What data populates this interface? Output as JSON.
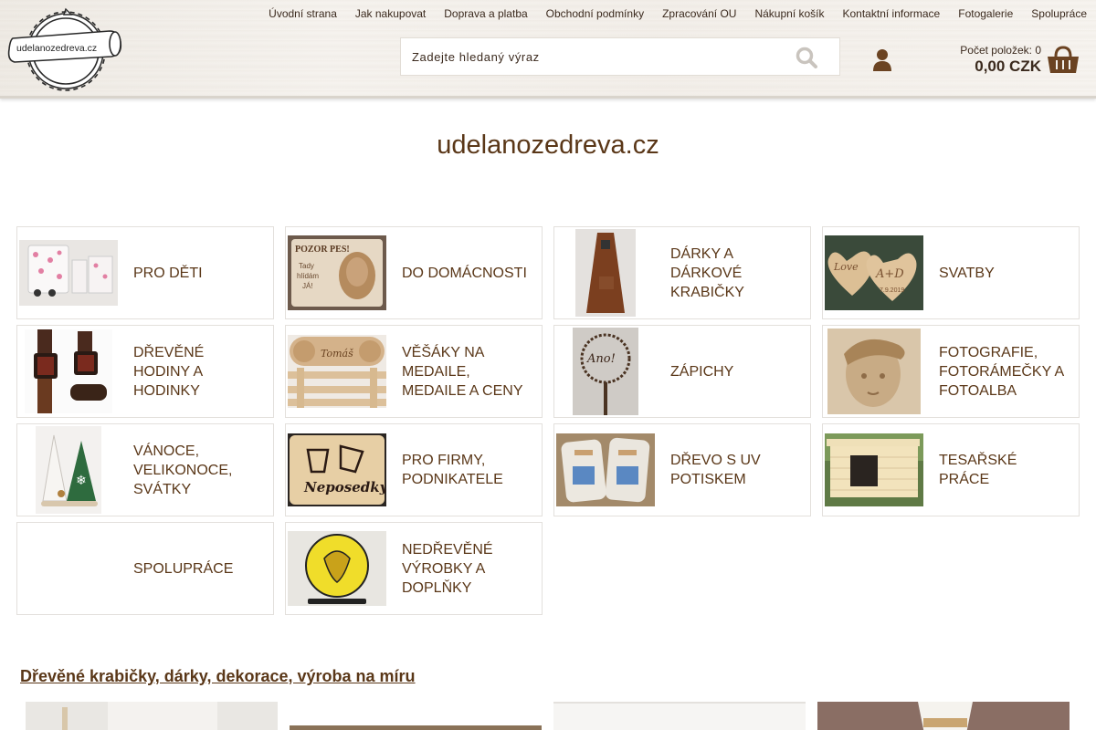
{
  "header": {
    "logo_text": "udelanozedreva.cz",
    "nav": [
      {
        "label": "Úvodní strana"
      },
      {
        "label": "Jak nakupovat"
      },
      {
        "label": "Doprava a platba"
      },
      {
        "label": "Obchodní podmínky"
      },
      {
        "label": "Zpracování OU"
      },
      {
        "label": "Nákupní košík"
      },
      {
        "label": "Kontaktní informace"
      },
      {
        "label": "Fotogalerie"
      },
      {
        "label": "Spolupráce"
      }
    ],
    "search": {
      "placeholder": "Zadejte hledaný výraz",
      "icon": "search-icon"
    },
    "user_icon": "user-icon",
    "cart": {
      "count_label": "Počet položek: 0",
      "total": "0,00 CZK",
      "icon": "basket-icon"
    }
  },
  "main": {
    "title": "udelanozedreva.cz",
    "categories": [
      {
        "label": "PRO DĚTI"
      },
      {
        "label": "DO DOMÁCNOSTI"
      },
      {
        "label": "DÁRKY A DÁRKOVÉ KRABIČKY"
      },
      {
        "label": "SVATBY"
      },
      {
        "label": "DŘEVĚNÉ HODINY A HODINKY"
      },
      {
        "label": "VĚŠÁKY NA MEDAILE, MEDAILE A CENY"
      },
      {
        "label": "ZÁPICHY"
      },
      {
        "label": "FOTOGRAFIE, FOTORÁMEČKY A FOTOALBA"
      },
      {
        "label": "VÁNOCE, VELIKONOCE, SVÁTKY"
      },
      {
        "label": "PRO FIRMY, PODNIKATELE"
      },
      {
        "label": "DŘEVO S UV POTISKEM"
      },
      {
        "label": "TESAŘSKÉ PRÁCE"
      },
      {
        "label": "SPOLUPRÁCE"
      },
      {
        "label": "NEDŘEVĚNÉ VÝROBKY A DOPLŇKY"
      }
    ],
    "thumb_texts": {
      "pozor_pes": "POZOR PES!",
      "tady_hlidam": "Tady",
      "tady_hlidam2": "hlídám",
      "tady_hlidam3": "JÁ!",
      "love": "Love",
      "initials": "A+D",
      "wedding_date": "7.9.2019",
      "nameplate": "Tomáš",
      "neposedky": "Neposedky",
      "cake_topper": "Ano!"
    },
    "section": {
      "title": "Dřevěné krabičky, dárky, dekorace, výroba na míru"
    }
  },
  "colors": {
    "brand_brown": "#5a3718",
    "text": "#3b2a1e",
    "border": "#e3e0dc"
  }
}
